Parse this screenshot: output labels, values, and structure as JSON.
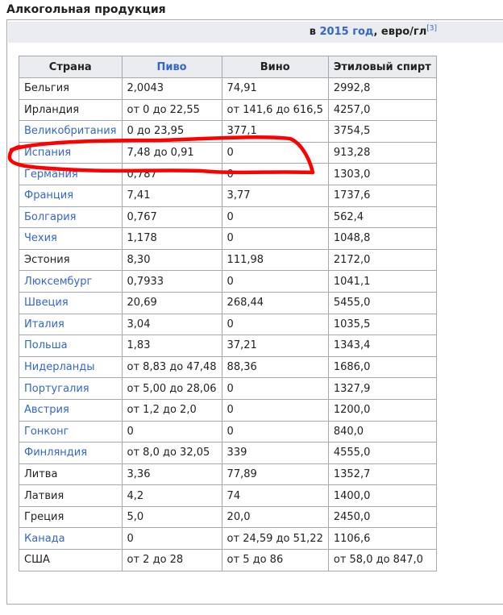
{
  "section_title": "Алкогольная продукция",
  "caption": {
    "prefix": "в ",
    "year_link": "2015 год",
    "suffix": ", евро/гл",
    "ref": "[3]"
  },
  "headers": [
    "Страна",
    "Пиво",
    "Вино",
    "Этиловый спирт"
  ],
  "rows": [
    {
      "country": "Бельгия",
      "link": false,
      "beer": "2,0043",
      "wine": "74,91",
      "spirit": "2992,8"
    },
    {
      "country": "Ирландия",
      "link": false,
      "beer": "от 0 до 22,55",
      "wine": "от 141,6 до 616,5",
      "spirit": "4257,0"
    },
    {
      "country": "Великобритания",
      "link": true,
      "beer": "0 до 23,95",
      "wine": "377,1",
      "spirit": "3754,5"
    },
    {
      "country": "Испания",
      "link": true,
      "beer": "7,48 до 0,91",
      "wine": "0",
      "spirit": "913,28"
    },
    {
      "country": "Германия",
      "link": true,
      "beer": "0,787",
      "wine": "0",
      "spirit": "1303,0"
    },
    {
      "country": "Франция",
      "link": true,
      "beer": "7,41",
      "wine": "3,77",
      "spirit": "1737,6"
    },
    {
      "country": "Болгария",
      "link": true,
      "beer": "0,767",
      "wine": "0",
      "spirit": "562,4"
    },
    {
      "country": "Чехия",
      "link": true,
      "beer": "1,178",
      "wine": "0",
      "spirit": "1048,8"
    },
    {
      "country": "Эстония",
      "link": false,
      "beer": "8,30",
      "wine": "111,98",
      "spirit": "2172,0"
    },
    {
      "country": "Люксембург",
      "link": true,
      "beer": "0,7933",
      "wine": "0",
      "spirit": "1041,1"
    },
    {
      "country": "Швеция",
      "link": true,
      "beer": "20,69",
      "wine": "268,44",
      "spirit": "5455,0"
    },
    {
      "country": "Италия",
      "link": true,
      "beer": "3,04",
      "wine": "0",
      "spirit": "1035,5"
    },
    {
      "country": "Польша",
      "link": true,
      "beer": "1,83",
      "wine": "37,21",
      "spirit": "1343,4"
    },
    {
      "country": "Нидерланды",
      "link": true,
      "beer": "от 8,83 до 47,48",
      "wine": "88,36",
      "spirit": "1686,0"
    },
    {
      "country": "Португалия",
      "link": true,
      "beer": "от 5,00 до 28,06",
      "wine": "0",
      "spirit": "1327,9"
    },
    {
      "country": "Австрия",
      "link": true,
      "beer": "от 1,2 до 2,0",
      "wine": "0",
      "spirit": "1200,0"
    },
    {
      "country": "Гонконг",
      "link": true,
      "beer": "0",
      "wine": "0",
      "spirit": "840,0"
    },
    {
      "country": "Финляндия",
      "link": true,
      "beer": "от 8,0 до 32,05",
      "wine": "339",
      "spirit": "4555,0"
    },
    {
      "country": "Литва",
      "link": false,
      "beer": "3,36",
      "wine": "77,89",
      "spirit": "1352,7"
    },
    {
      "country": "Латвия",
      "link": false,
      "beer": "4,2",
      "wine": "74",
      "spirit": "1400,0"
    },
    {
      "country": "Греция",
      "link": false,
      "beer": "5,0",
      "wine": "20,0",
      "spirit": "2450,0"
    },
    {
      "country": "Канада",
      "link": true,
      "beer": "0",
      "wine": "от 24,59 до 51,22",
      "spirit": "1106,6"
    },
    {
      "country": "США",
      "link": false,
      "beer": "от 2 до 28",
      "wine": "от 5 до 86",
      "spirit": "от 58,0 до 847,0"
    }
  ],
  "highlight_color": "#ff0000"
}
